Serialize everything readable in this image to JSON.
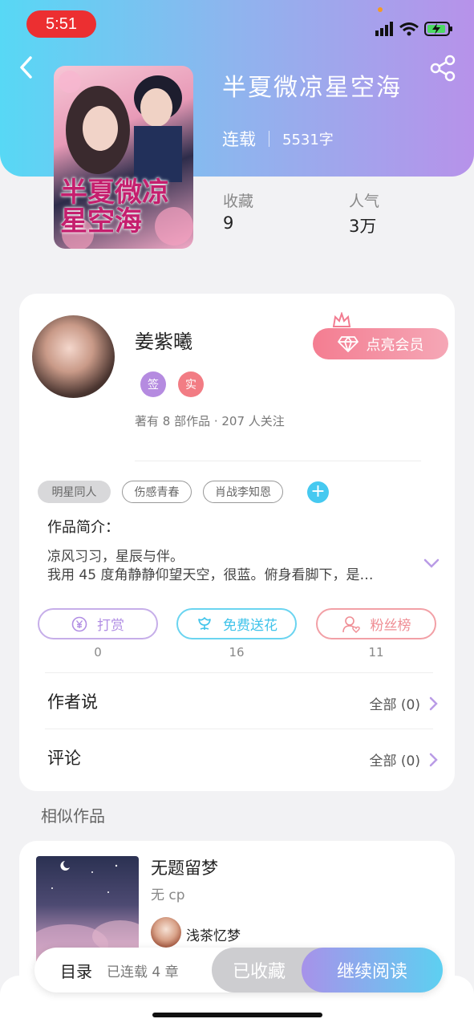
{
  "status_bar": {
    "time": "5:51"
  },
  "book": {
    "title": "半夏微凉星空海",
    "status": "连载",
    "word_count": "5531字",
    "cover_text": "半夏微凉星空海",
    "stats": [
      {
        "label": "收藏",
        "value": "9"
      },
      {
        "label": "人气",
        "value": "3万"
      }
    ]
  },
  "author": {
    "name": "姜紫曦",
    "badges": [
      {
        "text": "签",
        "color": "#b58be0"
      },
      {
        "text": "实",
        "color": "#f27c84"
      }
    ],
    "info": "著有 8 部作品 · 207 人关注",
    "vip_label": "点亮会员"
  },
  "tags": [
    "明星同人",
    "伤感青春",
    "肖战李知恩"
  ],
  "intro": {
    "heading": "作品简介：",
    "line1": "凉风习习，星辰与伴。",
    "line2": "我用 45 度角静静仰望天空，很蓝。俯身看脚下，是…"
  },
  "actions": [
    {
      "label": "打赏",
      "count": "0",
      "color": "#b99be6"
    },
    {
      "label": "免费送花",
      "count": "16",
      "color": "#5fd2ef"
    },
    {
      "label": "粉丝榜",
      "count": "11",
      "color": "#ef8d94"
    }
  ],
  "rows": [
    {
      "title": "作者说",
      "right": "全部 (0)"
    },
    {
      "title": "评论",
      "right": "全部 (0)"
    }
  ],
  "similar": {
    "heading": "相似作品",
    "item": {
      "title": "无题留梦",
      "subtitle": "无 cp",
      "author": "浅茶忆梦"
    }
  },
  "bottom": {
    "catalog": "目录",
    "chapters": "已连载 4 章",
    "collected": "已收藏",
    "continue": "继续阅读"
  }
}
